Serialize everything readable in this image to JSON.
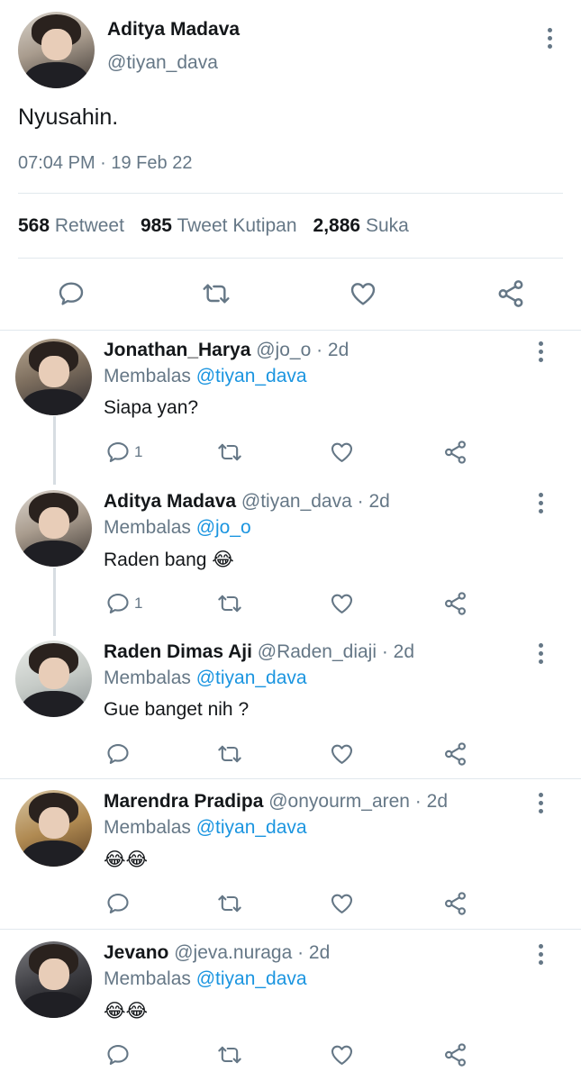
{
  "main_tweet": {
    "name": "Aditya Madava",
    "handle": "@tiyan_dava",
    "text": "Nyusahin.",
    "timestamp": "07:04 PM · 19 Feb 22",
    "stats": {
      "retweet_count": "568",
      "retweet_label": "Retweet",
      "quote_count": "985",
      "quote_label": "Tweet Kutipan",
      "like_count": "2,886",
      "like_label": "Suka"
    }
  },
  "replies": [
    {
      "name": "Jonathan_Harya",
      "handle_time": " @jo_o · 2d",
      "reply_prefix": "Membalas ",
      "reply_to": "@tiyan_dava",
      "text": "Siapa yan?",
      "reply_count": "1"
    },
    {
      "name": "Aditya Madava",
      "handle_time": " @tiyan_dava · 2d",
      "reply_prefix": "Membalas ",
      "reply_to": "@jo_o",
      "text": "Raden bang 😂",
      "reply_count": "1"
    },
    {
      "name": "Raden Dimas Aji",
      "handle_time": " @Raden_diaji · 2d",
      "reply_prefix": "Membalas ",
      "reply_to": "@tiyan_dava",
      "text": "Gue banget nih ?",
      "reply_count": ""
    },
    {
      "name": "Marendra Pradipa",
      "handle_time": " @onyourm_aren · 2d",
      "reply_prefix": "Membalas ",
      "reply_to": "@tiyan_dava",
      "text": "😂😂",
      "reply_count": ""
    },
    {
      "name": "Jevano",
      "handle_time": " @jeva.nuraga · 2d",
      "reply_prefix": "Membalas ",
      "reply_to": "@tiyan_dava",
      "text": "😂😂",
      "reply_count": ""
    }
  ],
  "colors": {
    "accent": "#1b95e0",
    "secondary_text": "#657786",
    "divider": "#e1e8ed"
  },
  "icons": [
    "reply-icon",
    "retweet-icon",
    "like-icon",
    "share-icon",
    "more-options-icon"
  ]
}
